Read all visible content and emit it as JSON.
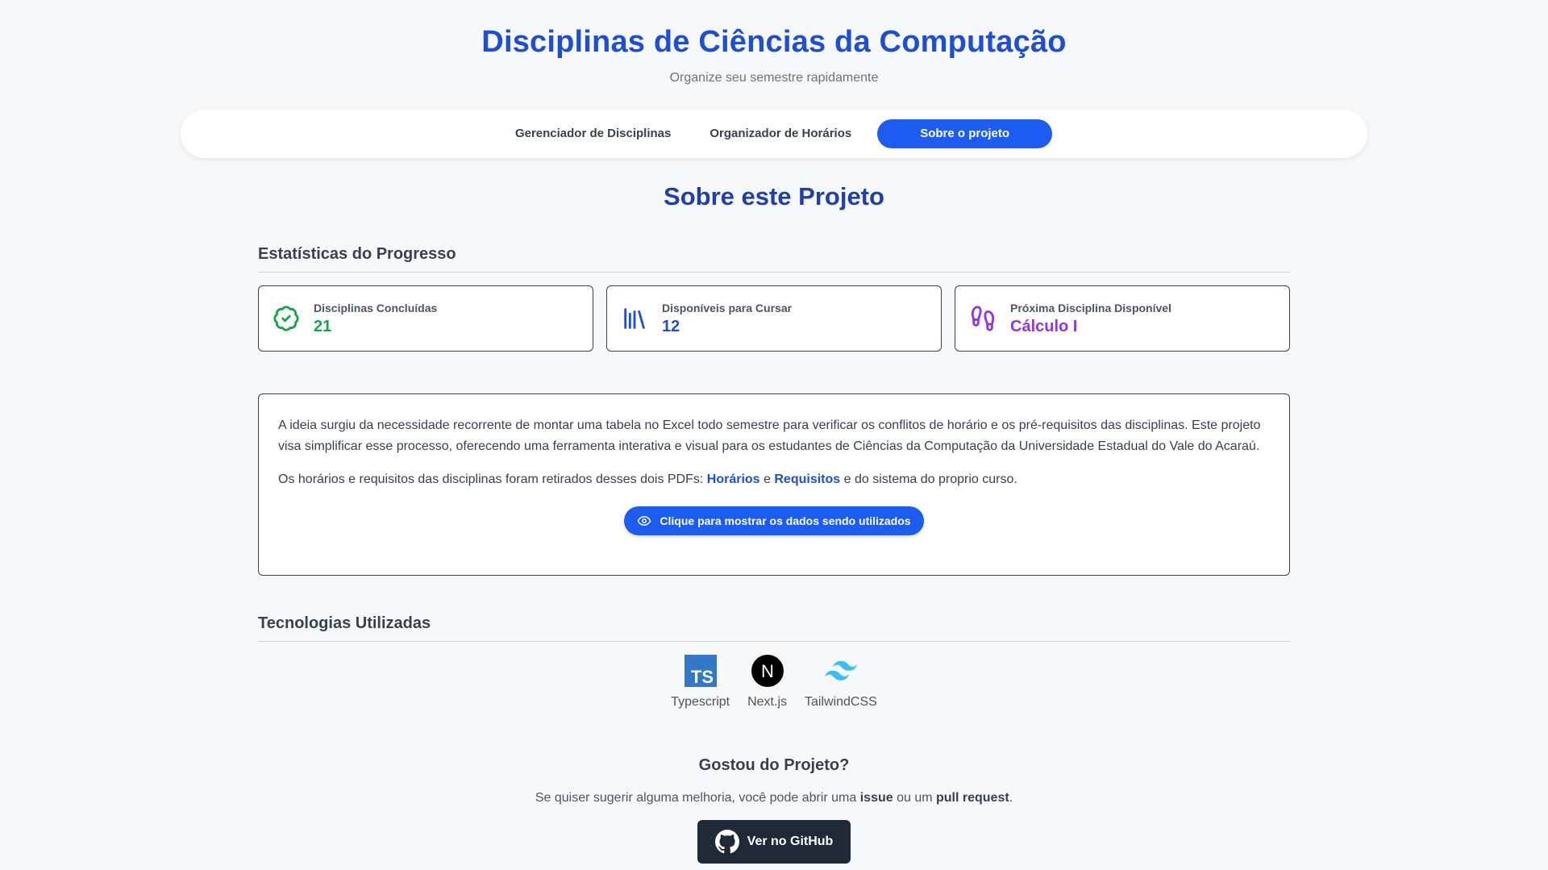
{
  "header": {
    "title": "Disciplinas de Ciências da Computação",
    "subtitle": "Organize seu semestre rapidamente"
  },
  "nav": {
    "tabs": [
      {
        "label": "Gerenciador de Disciplinas",
        "active": false
      },
      {
        "label": "Organizador de Horários",
        "active": false
      },
      {
        "label": "Sobre o projeto",
        "active": true
      }
    ]
  },
  "main": {
    "title": "Sobre este Projeto",
    "stats": {
      "heading": "Estatísticas do Progresso",
      "cards": [
        {
          "label": "Disciplinas Concluídas",
          "value": "21",
          "icon": "badge-check-icon",
          "color": "#16a34a"
        },
        {
          "label": "Disponíveis para Cursar",
          "value": "12",
          "icon": "books-icon",
          "color": "#1d4ed8"
        },
        {
          "label": "Próxima Disciplina Disponível",
          "value": "Cálculo I",
          "icon": "footprints-icon",
          "color": "#9333ea"
        }
      ]
    },
    "about": {
      "paragraph1": "A ideia surgiu da necessidade recorrente de montar uma tabela no Excel todo semestre para verificar os conflitos de horário e os pré-requisitos das disciplinas. Este projeto visa simplificar esse processo, oferecendo uma ferramenta interativa e visual para os estudantes de Ciências da Computação da Universidade Estadual do Vale do Acaraú.",
      "paragraph2_prefix": "Os horários e requisitos das disciplinas foram retirados desses dois PDFs: ",
      "link1": "Horários",
      "connector": " e ",
      "link2": "Requisitos",
      "paragraph2_suffix": " e do sistema do proprio curso.",
      "button_label": "Clique para mostrar os dados sendo utilizados"
    },
    "tech": {
      "heading": "Tecnologias Utilizadas",
      "items": [
        {
          "label": "Typescript",
          "icon": "typescript-icon",
          "icon_text": "TS"
        },
        {
          "label": "Next.js",
          "icon": "nextjs-icon",
          "icon_text": "N"
        },
        {
          "label": "TailwindCSS",
          "icon": "tailwind-icon"
        }
      ]
    }
  },
  "footer": {
    "title": "Gostou do Projeto?",
    "text_prefix": "Se quiser sugerir alguma melhoria, você pode abrir uma ",
    "bold1": "issue",
    "text_mid": " ou um ",
    "bold2": "pull request",
    "text_suffix": ".",
    "button_label": "Ver no GitHub"
  },
  "colors": {
    "primary": "#1d5cf0",
    "title": "#1d4ed8",
    "green": "#16a34a",
    "purple": "#9333ea"
  }
}
